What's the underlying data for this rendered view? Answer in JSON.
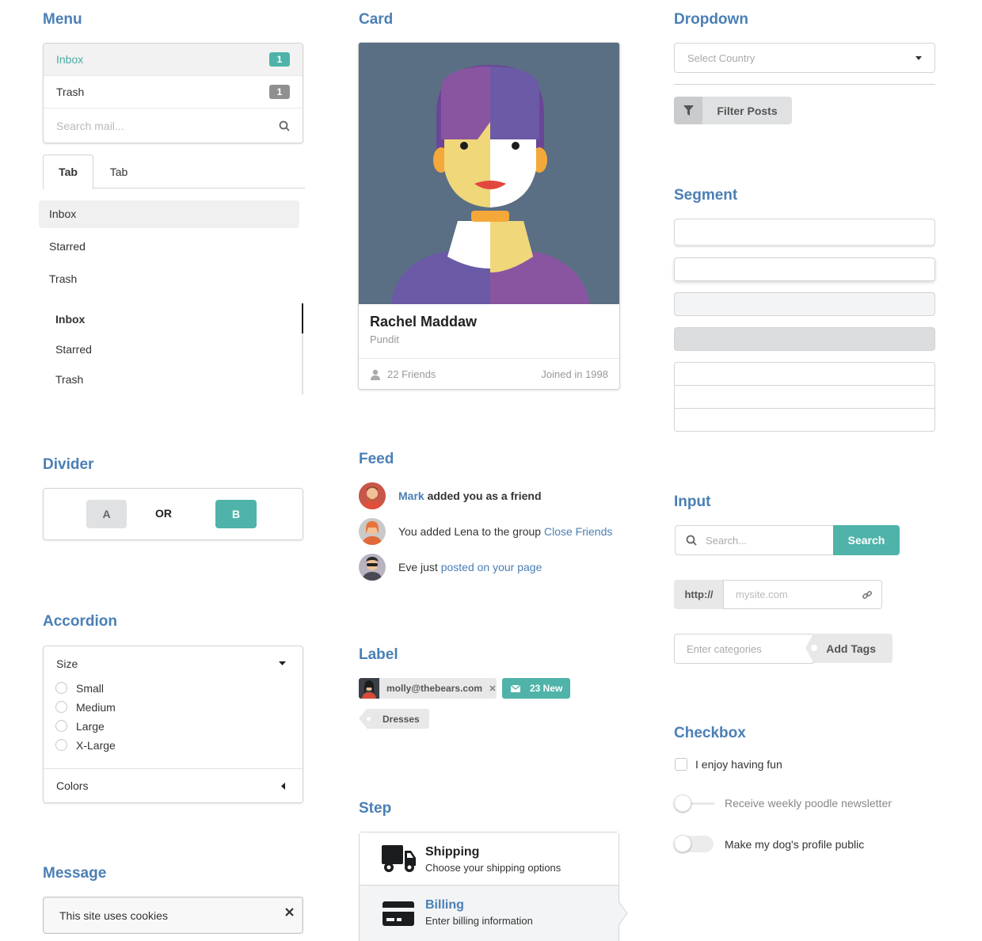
{
  "sections": {
    "menu": "Menu",
    "card": "Card",
    "dropdown": "Dropdown",
    "segment": "Segment",
    "divider": "Divider",
    "feed": "Feed",
    "input": "Input",
    "accordion": "Accordion",
    "label": "Label",
    "checkbox": "Checkbox",
    "step": "Step",
    "message": "Message"
  },
  "menu": {
    "items": [
      {
        "label": "Inbox",
        "count": "1"
      },
      {
        "label": "Trash",
        "count": "1"
      }
    ],
    "search_placeholder": "Search mail..."
  },
  "tabs": [
    "Tab",
    "Tab"
  ],
  "vertical_menu": [
    "Inbox",
    "Starred",
    "Trash"
  ],
  "pointing_menu": [
    "Inbox",
    "Starred",
    "Trash"
  ],
  "card": {
    "name": "Rachel Maddaw",
    "meta": "Pundit",
    "friends": "22 Friends",
    "joined": "Joined in 1998"
  },
  "dropdown": {
    "placeholder": "Select Country",
    "filter_label": "Filter Posts"
  },
  "divider": {
    "a": "A",
    "or": "OR",
    "b": "B"
  },
  "feed": [
    {
      "link1": "Mark",
      "text": " added you as a friend"
    },
    {
      "text": "You added Lena to the group ",
      "link2": "Close Friends"
    },
    {
      "text": "Eve just ",
      "link2": "posted on your page"
    }
  ],
  "accordion": {
    "title1": "Size",
    "options": [
      "Small",
      "Medium",
      "Large",
      "X-Large"
    ],
    "title2": "Colors"
  },
  "message": {
    "text": "This site uses cookies"
  },
  "labels": {
    "email": "molly@thebears.com",
    "new": "23 New",
    "tag": "Dresses"
  },
  "steps": [
    {
      "title": "Shipping",
      "desc": "Choose your shipping options"
    },
    {
      "title": "Billing",
      "desc": "Enter billing information"
    }
  ],
  "input": {
    "search_placeholder": "Search...",
    "search_button": "Search",
    "url_prefix": "http://",
    "url_placeholder": "mysite.com",
    "tags_placeholder": "Enter categories",
    "tags_button": "Add Tags"
  },
  "checkbox": {
    "c1": "I enjoy having fun",
    "c2": "Receive weekly poodle newsletter",
    "c3": "Make my dog's profile public"
  },
  "colors": {
    "accent": "#4fb3a9",
    "link": "#4a7fb5",
    "card_bg": "#5a6f84"
  }
}
